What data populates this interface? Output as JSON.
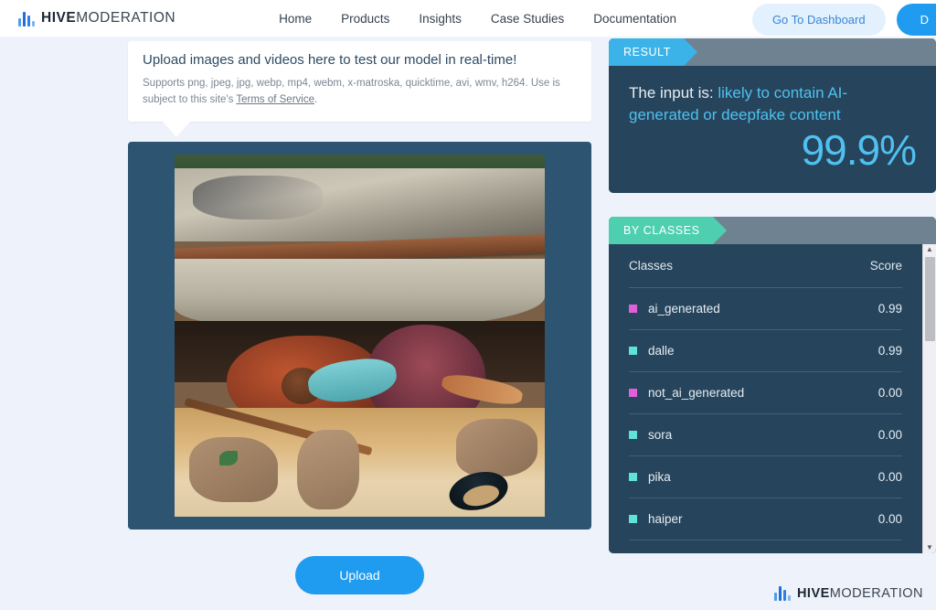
{
  "header": {
    "logo_icon": "hive-bars-icon",
    "brand_hive": "HIVE",
    "brand_moderation": "MODERATION",
    "nav": [
      {
        "label": "Home"
      },
      {
        "label": "Products"
      },
      {
        "label": "Insights"
      },
      {
        "label": "Case Studies"
      },
      {
        "label": "Documentation"
      }
    ],
    "dashboard_button": "Go To Dashboard",
    "primary_button": "D"
  },
  "upload_card": {
    "title": "Upload images and videos here to test our model in real-time!",
    "supports_prefix": "Supports png, jpeg, jpg, webp, mp4, webm, x-matroska, quicktime, avi, wmv, h264. Use is subject to this site's ",
    "terms_link": "Terms of Service",
    "supports_suffix": "."
  },
  "preview": {
    "alt": "uploaded-image-flood-shelter-scene"
  },
  "upload_button": {
    "label": "Upload"
  },
  "result_panel": {
    "tab_label": "RESULT",
    "prefix": "The input is: ",
    "verdict": "likely to contain AI-generated or deepfake content",
    "percentage": "99.9%"
  },
  "classes_panel": {
    "tab_label": "BY CLASSES",
    "col_class": "Classes",
    "col_score": "Score",
    "rows": [
      {
        "name": "ai_generated",
        "score": "0.99",
        "color": "#e060d8"
      },
      {
        "name": "dalle",
        "score": "0.99",
        "color": "#5fe3d8"
      },
      {
        "name": "not_ai_generated",
        "score": "0.00",
        "color": "#e060d8"
      },
      {
        "name": "sora",
        "score": "0.00",
        "color": "#5fe3d8"
      },
      {
        "name": "pika",
        "score": "0.00",
        "color": "#5fe3d8"
      },
      {
        "name": "haiper",
        "score": "0.00",
        "color": "#5fe3d8"
      }
    ],
    "scroll_up_icon": "▲",
    "scroll_down_icon": "▼"
  },
  "footer": {
    "brand_hive": "HIVE",
    "brand_moderation": "MODERATION"
  },
  "colors": {
    "accent_blue": "#1f9bf0",
    "result_tab": "#3bb3e8",
    "classes_tab": "#4ecfb0",
    "panel_bg": "#26455c",
    "frame": "#2d5571",
    "page_bg": "#eef2fa"
  }
}
